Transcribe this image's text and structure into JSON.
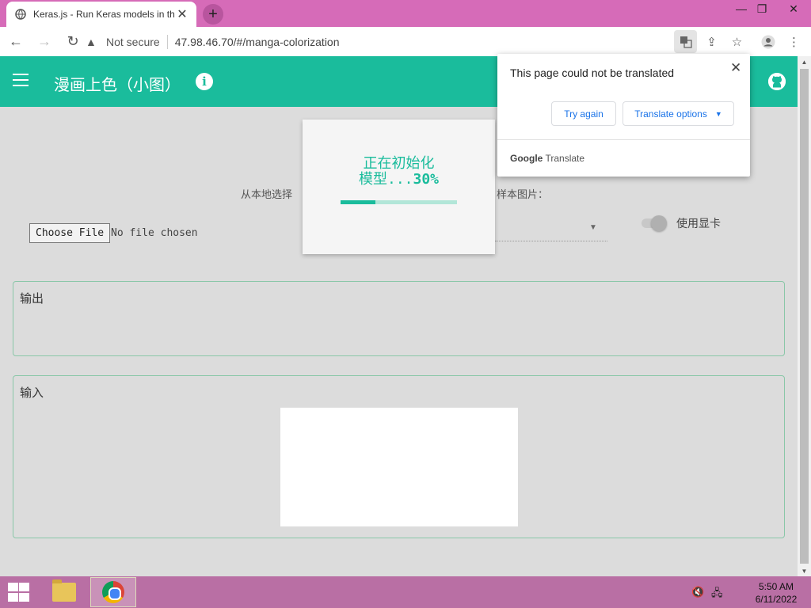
{
  "browser": {
    "tab_title": "Keras.js - Run Keras models in th",
    "tab_close": "✕",
    "new_tab": "+",
    "security_label": "Not secure",
    "url": "47.98.46.70/#/manga-colorization"
  },
  "app": {
    "title": "漫画上色（小图）",
    "info_glyph": "i"
  },
  "page": {
    "hint_left": "从本地选择",
    "hint_right": "样本图片：",
    "file_button": "Choose File",
    "file_status": "No file chosen",
    "gpu_label": "使用显卡",
    "gpu_enabled": false,
    "output_title": "输出",
    "input_title": "输入"
  },
  "loader": {
    "line1": "正在初始化",
    "line2": "模型...",
    "percent_text": "30%",
    "progress": 0.3
  },
  "translate_popup": {
    "message": "This page could not be translated",
    "close": "✕",
    "try_again": "Try again",
    "options": "Translate options",
    "brand_google": "Google",
    "brand_translate": "Translate"
  },
  "taskbar": {
    "time": "5:50 AM",
    "date": "6/11/2022"
  },
  "colors": {
    "accent": "#1abc9c",
    "titlebar": "#d66bb8",
    "taskbar": "#b96fa4",
    "link": "#1a73e8"
  }
}
